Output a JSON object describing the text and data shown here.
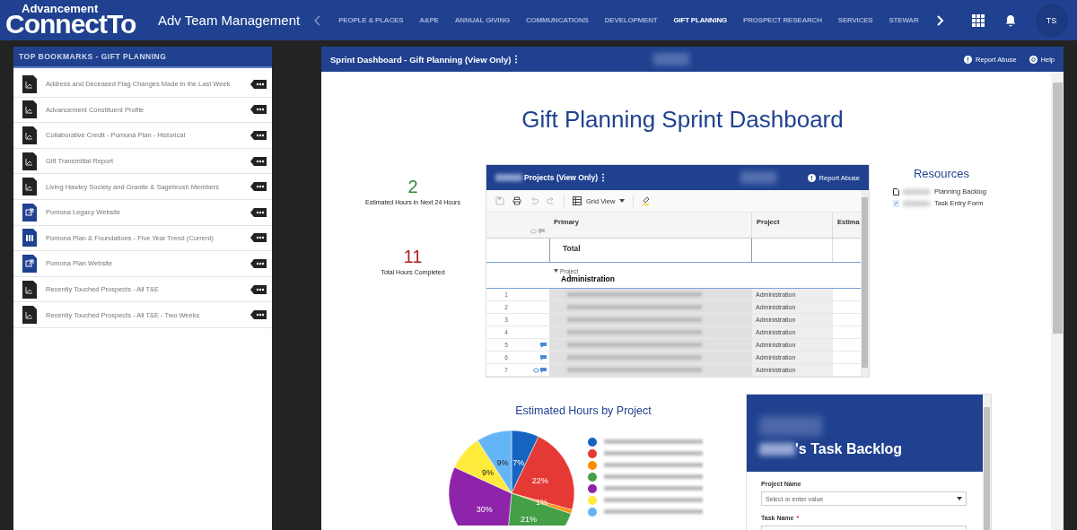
{
  "header": {
    "logo_top": "Advancement",
    "logo_main": "ConnectTo",
    "app_title": "Adv Team Management",
    "nav": [
      {
        "label": "PEOPLE & PLACES",
        "selected": false
      },
      {
        "label": "A&PE",
        "selected": false
      },
      {
        "label": "ANNUAL GIVING",
        "selected": false
      },
      {
        "label": "COMMUNCATIONS",
        "selected": false
      },
      {
        "label": "DEVELOPMENT",
        "selected": false
      },
      {
        "label": "GIFT PLANNING",
        "selected": true
      },
      {
        "label": "PROSPECT RESEARCH",
        "selected": false
      },
      {
        "label": "SERVICES",
        "selected": false
      },
      {
        "label": "STEWAR",
        "selected": false
      }
    ],
    "avatar": "TS"
  },
  "sidebar": {
    "title": "TOP BOOKMARKS - GIFT PLANNING",
    "items": [
      {
        "kind": "report",
        "label": "Address and Deceased Flag Changes Made in the Last Week"
      },
      {
        "kind": "report",
        "label": "Advancement Constituent Profile"
      },
      {
        "kind": "report",
        "label": "Collaborative Credit - Pomona Plan - Historical"
      },
      {
        "kind": "report",
        "label": "Gift Transmittal Report"
      },
      {
        "kind": "report",
        "label": "Living Hawley Society and Granite & Sagebrush Members"
      },
      {
        "kind": "link",
        "label": "Pomona Legacy Website"
      },
      {
        "kind": "sheet",
        "label": "Pomona Plan & Foundations - Five Year Trend (Current)"
      },
      {
        "kind": "link",
        "label": "Pomona Plan Website"
      },
      {
        "kind": "report",
        "label": "Recently Touched Prospects - All T&E"
      },
      {
        "kind": "report",
        "label": "Recently Touched Prospects - All T&E - Two Weeks"
      }
    ]
  },
  "panel": {
    "title": "Sprint Dashboard - Gift Planning (View Only)",
    "report_abuse": "Report Abuse",
    "help": "Help",
    "dashboard_title": "Gift Planning Sprint Dashboard",
    "metrics": [
      {
        "value": "2",
        "label": "Estimated Hours in Next 24 Hours",
        "color": "#2e8b3a"
      },
      {
        "value": "11",
        "label": "Total Hours Completed",
        "color": "#b22222"
      }
    ],
    "embedded_sheet": {
      "title": "Projects (View Only)",
      "report_abuse": "Report Abuse",
      "view_button": "Grid View",
      "columns": [
        "Primary",
        "Project",
        "Estima"
      ],
      "total_label": "Total",
      "group_caption": "Project",
      "group_name": "Administration",
      "rows": [
        {
          "number": "1",
          "comment": false,
          "attachment": false,
          "project": "Administration"
        },
        {
          "number": "2",
          "comment": false,
          "attachment": false,
          "project": "Administration"
        },
        {
          "number": "3",
          "comment": false,
          "attachment": false,
          "project": "Administration"
        },
        {
          "number": "4",
          "comment": false,
          "attachment": false,
          "project": "Administration"
        },
        {
          "number": "5",
          "comment": true,
          "attachment": false,
          "project": "Administration"
        },
        {
          "number": "6",
          "comment": true,
          "attachment": false,
          "project": "Administration"
        },
        {
          "number": "7",
          "comment": true,
          "attachment": true,
          "project": "Administration"
        }
      ]
    },
    "resources": {
      "title": "Resources",
      "items": [
        {
          "kind": "sheet",
          "label": "Planning Backlog"
        },
        {
          "kind": "link",
          "label": "Task Entry Form"
        }
      ]
    },
    "chart": {
      "legend": [
        {
          "color": "#1565c0"
        },
        {
          "color": "#e53935"
        },
        {
          "color": "#fb8c00"
        },
        {
          "color": "#43a047"
        },
        {
          "color": "#8e24aa"
        },
        {
          "color": "#ffeb3b"
        },
        {
          "color": "#64b5f6"
        }
      ],
      "chart_data": {
        "type": "pie",
        "title": "Estimated Hours by Project",
        "values": [
          7,
          22,
          1,
          21,
          30,
          9,
          9
        ],
        "value_labels": [
          "7%",
          "22%",
          "1%",
          "21%",
          "30%",
          "9%",
          "9%"
        ]
      }
    },
    "form": {
      "title": "'s Task Backlog",
      "fields": [
        {
          "label": "Project Name",
          "placeholder": "Select or enter value",
          "kind": "select"
        },
        {
          "label": "Task Name",
          "required_mark": "*",
          "kind": "text"
        }
      ]
    }
  }
}
